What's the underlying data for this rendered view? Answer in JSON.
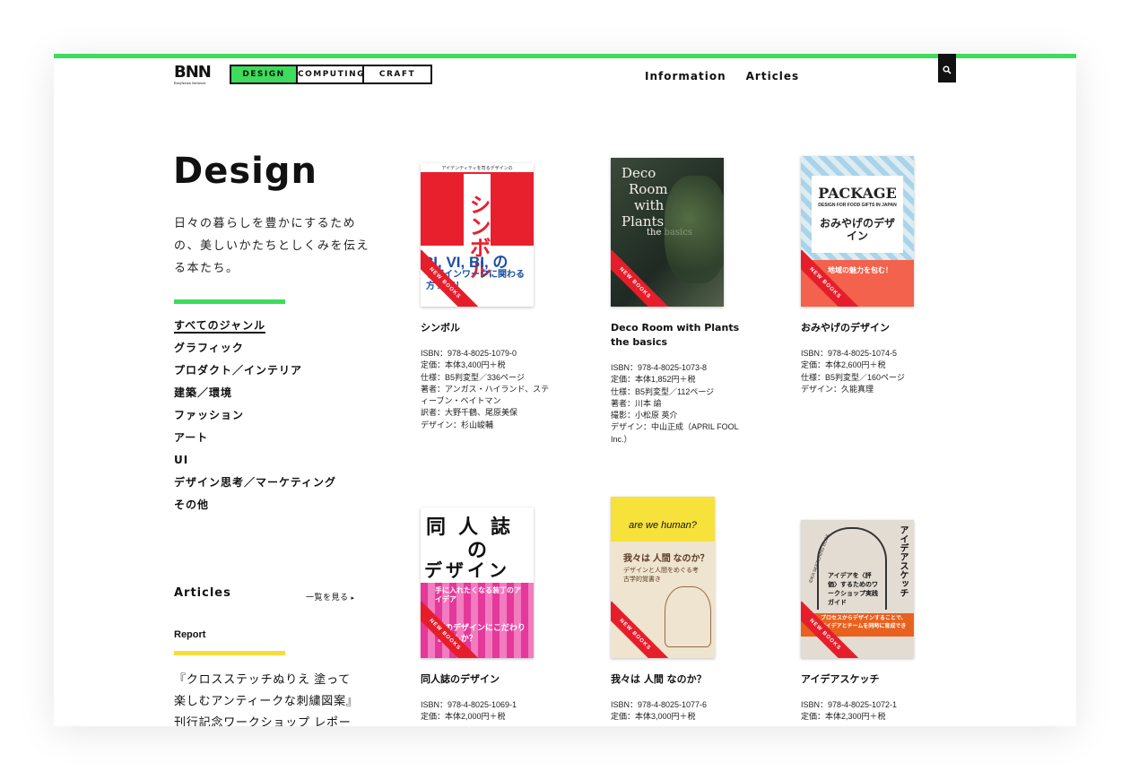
{
  "logo": {
    "text": "BNN",
    "sub": "Bnn|News Network"
  },
  "tabs": [
    {
      "label": "DESIGN",
      "active": true
    },
    {
      "label": "COMPUTING",
      "active": false
    },
    {
      "label": "CRAFT",
      "active": false
    }
  ],
  "nav": {
    "information": "Information",
    "articles": "Articles"
  },
  "search_icon": "search-icon",
  "page": {
    "title": "Design",
    "description": "日々の暮らしを豊かにするための、美しいかたちとしくみを伝える本たち。"
  },
  "genres": [
    "すべてのジャンル",
    "グラフィック",
    "プロダクト／インテリア",
    "建築／環境",
    "ファッション",
    "アート",
    "UI",
    "デザイン思考／マーケティング",
    "その他"
  ],
  "articles": {
    "heading": "Articles",
    "view_all": "一覧を見る",
    "report_label": "Report",
    "report_title": "『クロスステッチぬりえ 塗って楽しむアンティークな刺繍図案』刊行記念ワークショップ レポート"
  },
  "ribbon_text": "NEW BOOKS",
  "books": [
    {
      "title": "シンボル",
      "meta": [
        "ISBN：978-4-8025-1079-0",
        "定価：本体3,400円＋税",
        "仕様：B5判変型／336ページ",
        "著者：アンガス・ハイランド、スティーブン・ベイトマン",
        "訳者：大野千鶴、尾原美保",
        "デザイン：杉山峻輔"
      ],
      "cover": {
        "top_text": "アイデンティティを司るデザインの",
        "big": "シンボル",
        "mid": "CI, VI, BI, の",
        "sub": "デザインワークに関わる方 必携！"
      }
    },
    {
      "title": "Deco Room with Plants　the basics",
      "meta": [
        "ISBN：978-4-8025-1073-8",
        "定価：本体1,852円＋税",
        "仕様：B5判変型／112ページ",
        "著者：川本 諭",
        "撮影：小松原 英介",
        "デザイン：中山正成（APRIL FOOL Inc.）"
      ],
      "cover": {
        "lines": [
          "Deco",
          "Room",
          "with",
          "Plants"
        ],
        "sub": "the basics"
      }
    },
    {
      "title": "おみやげのデザイン",
      "meta": [
        "ISBN：978-4-8025-1074-5",
        "定価：本体2,600円＋税",
        "仕様：B5判変型／160ページ",
        "デザイン：久能真理"
      ],
      "cover": {
        "top": "PACKAGE",
        "en": "DESIGN FOR FOOD GIFTS IN JAPAN",
        "jp": "おみやげのデザイン",
        "band": "地域の魅力を包む！"
      }
    },
    {
      "title": "同人誌のデザイン",
      "meta": [
        "ISBN：978-4-8025-1069-1",
        "定価：本体2,000円＋税"
      ],
      "cover": {
        "line1": "同人誌",
        "line2": "の",
        "line3": "デザイン",
        "sub": "手に入れたくなる装丁のアイデア",
        "bottom": "紙のデザインにこだわりませんか？"
      }
    },
    {
      "title": "我々は 人間 なのか？",
      "meta": [
        "ISBN：978-4-8025-1077-6",
        "定価：本体3,000円＋税"
      ],
      "cover": {
        "en": "are we human?",
        "jp": "我々は 人間 なのか？",
        "sub": "デザインと人間をめぐる考古学的覚書き"
      }
    },
    {
      "title": "アイデアスケッチ",
      "meta": [
        "ISBN：978-4-8025-1072-1",
        "定価：本体2,300円＋税"
      ],
      "cover": {
        "side": "アイデアスケッチ",
        "arc": "IDEA SKETCHING BOOK",
        "jp": "アイデアを〈評価〉するためのワークショップ実践ガイド",
        "band": "プロセスからデザインすることで、アイデアとチームを同時に育成できる"
      }
    }
  ],
  "colors": {
    "accent_green": "#3ddc5a",
    "report_yellow": "#f7dc3a",
    "ribbon_red": "#e61e2b"
  }
}
